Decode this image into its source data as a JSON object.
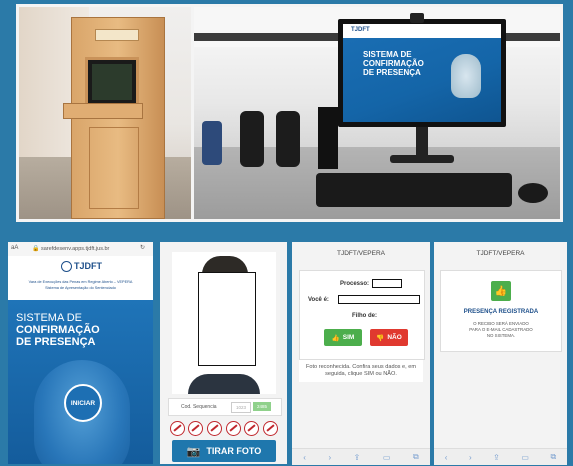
{
  "colors": {
    "background": "#2b7aa8",
    "brand_blue": "#1d6fb3",
    "green": "#4cae4c",
    "red": "#e0392f"
  },
  "photos": {
    "monitor_title": [
      "SISTEMA DE",
      "CONFIRMAÇÃO",
      "DE PRESENÇA"
    ],
    "monitor_logo": "TJDFT"
  },
  "phone1": {
    "url": "sarefdesenv.apps.tjdft.jus.br",
    "aa": "aA",
    "logo": "TJDFT",
    "org_line1": "Vara de Execuções das Penas em Regime Aberto – VEPERA",
    "org_line2": "Sistema de Apresentação do Sentenciado",
    "title_lines": [
      "SISTEMA DE",
      "CONFIRMAÇÃO",
      "DE PRESENÇA"
    ],
    "start_button": "INICIAR"
  },
  "phone2": {
    "sequence_label": "Cod. Sequencia",
    "sequence_value_1": "1023",
    "sequence_value_2": "2485",
    "photo_button": "TIRAR FOTO",
    "prohibited_icons": [
      "no-hat-icon",
      "no-cap-icon",
      "no-helmet-icon",
      "no-sunglasses-icon",
      "no-mask-icon",
      "no-hood-icon"
    ]
  },
  "phone3": {
    "header": "TJDFT/VEPERA",
    "processo_label": "Processo:",
    "voce_label": "Você é:",
    "filho_label": "Filho de:",
    "yes_button": "SIM",
    "no_button": "NÃO",
    "message": "Foto reconhecida. Confira seus dados e, em seguida, clique SIM ou NÃO."
  },
  "phone4": {
    "header": "TJDFT/VEPERA",
    "status_title": "PRESENÇA REGISTRADA",
    "status_text": [
      "O RECIBO SERÁ ENVIADO",
      "PARA O E-MAIL CADASTRADO",
      "NO SISTEMA."
    ]
  }
}
